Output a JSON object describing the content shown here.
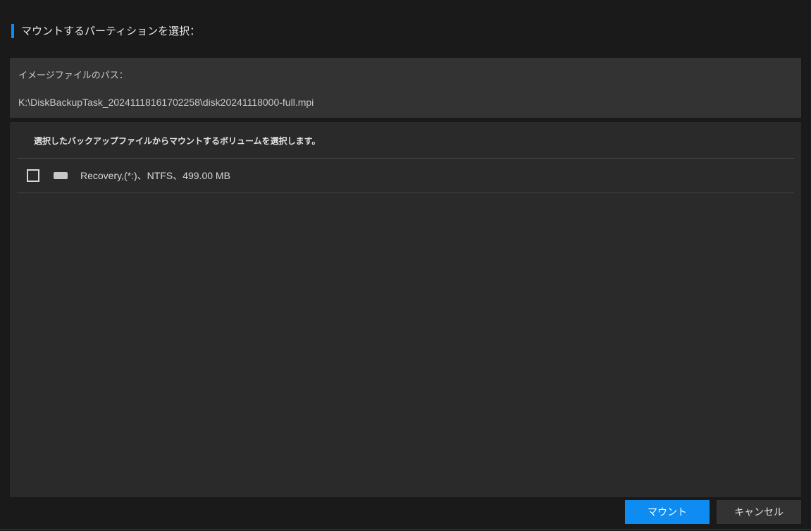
{
  "header": {
    "title": "マウントするパーティションを選択："
  },
  "path": {
    "label": "イメージファイルのパス：",
    "value": "K:\\DiskBackupTask_20241118161702258\\disk20241118000-full.mpi"
  },
  "volume": {
    "instruction": "選択したバックアップファイルからマウントするボリュームを選択します。",
    "items": [
      {
        "label": "Recovery,(*:)、NTFS、499.00 MB"
      }
    ]
  },
  "footer": {
    "mount_label": "マウント",
    "cancel_label": "キャンセル"
  }
}
